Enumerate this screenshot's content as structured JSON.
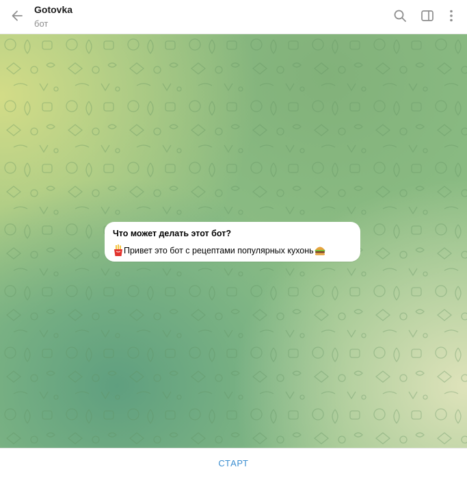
{
  "header": {
    "title": "Gotovka",
    "subtitle": "бот",
    "back_icon": "arrow-left-icon",
    "search_icon": "search-icon",
    "sidebar_icon": "sidebar-toggle-icon",
    "menu_icon": "more-vertical-icon"
  },
  "message": {
    "title": "Что может делать этот бот?",
    "leading_emoji": "fries-emoji",
    "text": "Привет это бот с рецептами популярных кухонь",
    "trailing_emoji": "burger-emoji"
  },
  "bottom": {
    "start_label": "СТАРТ"
  },
  "colors": {
    "accent": "#3b8ed0",
    "bg_yellow": "#cfd98a",
    "bg_green": "#6fa883",
    "bg_light": "#d6dfb0"
  }
}
